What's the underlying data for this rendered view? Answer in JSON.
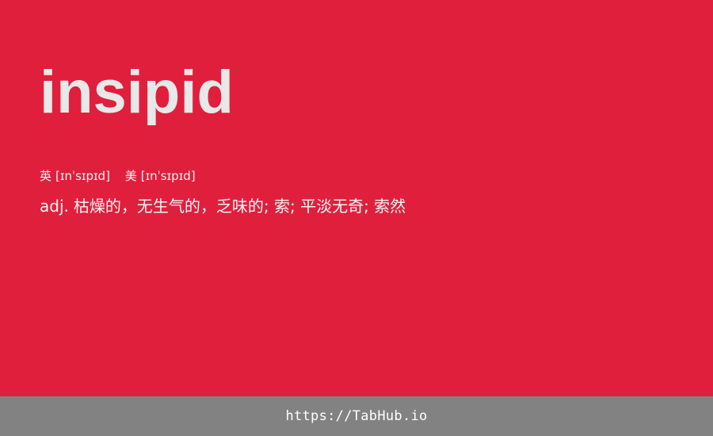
{
  "card": {
    "word": "insipid",
    "phonetics": [
      {
        "region": "英",
        "ipa": "[ɪnˈsɪpɪd]"
      },
      {
        "region": "美",
        "ipa": "[ɪnˈsɪpɪd]"
      }
    ],
    "definition": {
      "part_of_speech": "adj.",
      "meaning": "枯燥的，无生气的，乏味的; 索; 平淡无奇; 索然"
    }
  },
  "footer": {
    "link_text": "https://TabHub.io"
  },
  "colors": {
    "card_background": "#e01f3d",
    "footer_background": "#828282",
    "word_color": "#e8e8e8",
    "text_color": "#ffffff"
  }
}
